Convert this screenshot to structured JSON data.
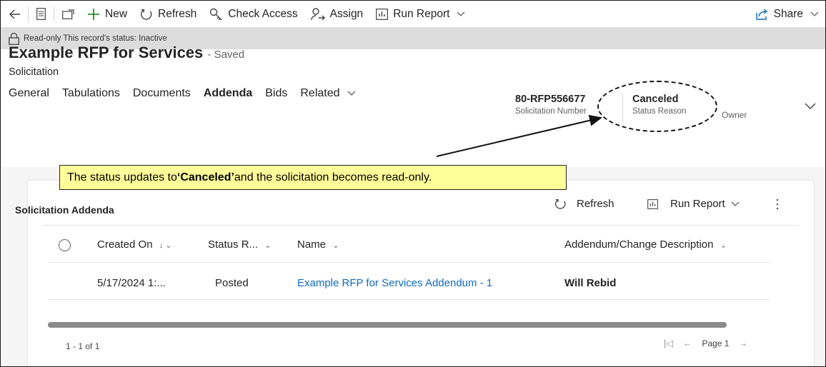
{
  "toolbar": {
    "new_label": "New",
    "refresh_label": "Refresh",
    "check_access_label": "Check Access",
    "assign_label": "Assign",
    "run_report_label": "Run Report",
    "share_label": "Share"
  },
  "notification": {
    "text": "Read-only This record's status: Inactive"
  },
  "record": {
    "title": "Example RFP for Services",
    "saved_status": "- Saved",
    "entity": "Solicitation",
    "header_fields": {
      "solicitation_number_value": "80-RFP556677",
      "solicitation_number_label": "Solicitation Number",
      "status_reason_value": "Canceled",
      "status_reason_label": "Status Reason",
      "owner_label": "Owner"
    }
  },
  "tabs": [
    "General",
    "Tabulations",
    "Documents",
    "Addenda",
    "Bids",
    "Related"
  ],
  "active_tab": "Addenda",
  "callout": {
    "prefix": "The status updates to ",
    "highlight": "‘Canceled’",
    "suffix": " and the solicitation becomes read-only."
  },
  "subgrid": {
    "title": "Solicitation Addenda",
    "refresh_label": "Refresh",
    "run_report_label": "Run Report",
    "columns": [
      "Created On",
      "Status R...",
      "Name",
      "Addendum/Change Description"
    ],
    "rows": [
      {
        "created_on": "5/17/2024 1:...",
        "status_reason": "Posted",
        "name": "Example RFP for Services Addendum - 1",
        "description": "Will Rebid"
      }
    ],
    "record_count": "1 - 1 of 1",
    "page_label": "Page 1"
  }
}
